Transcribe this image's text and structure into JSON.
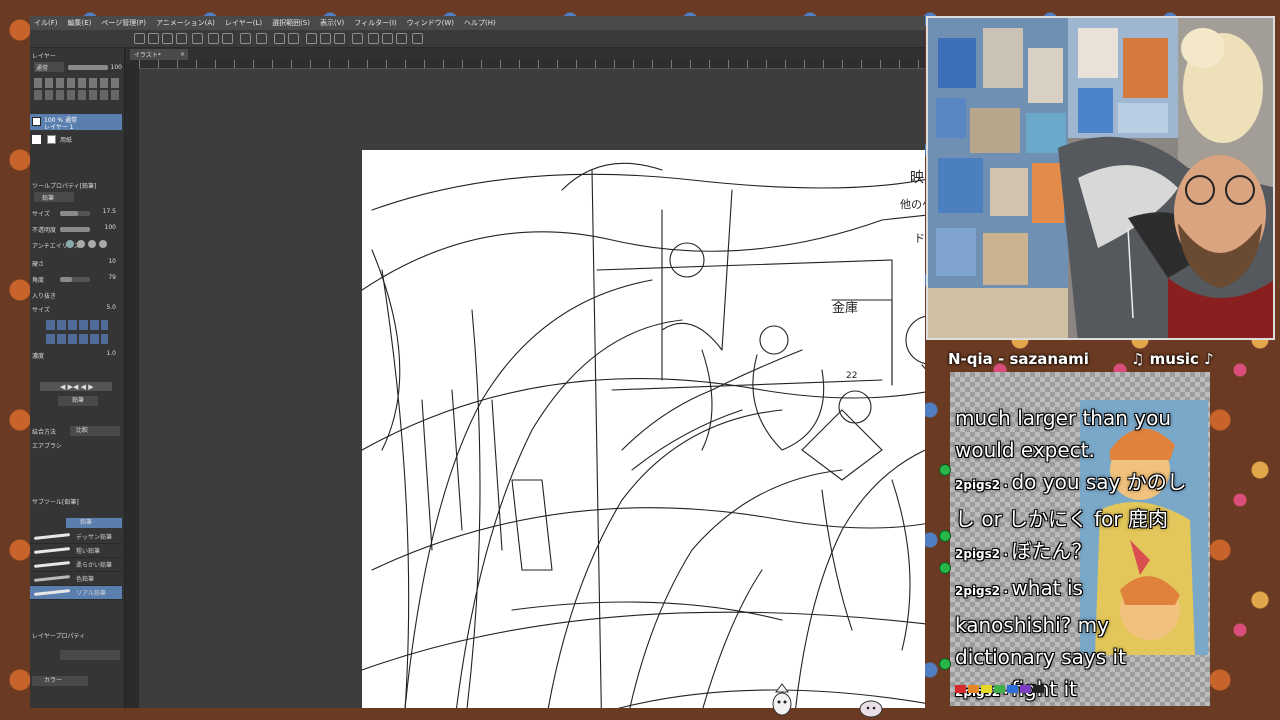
{
  "app": {
    "menu": [
      "イル(F)",
      "編集(E)",
      "ページ管理(P)",
      "アニメーション(A)",
      "レイヤー(L)",
      "選択範囲(S)",
      "表示(V)",
      "フィルター(I)",
      "ウィンドウ(W)",
      "ヘルプ(H)"
    ],
    "document_tab": "イラスト*",
    "zoom": "100",
    "layers": {
      "title": "レイヤー",
      "blend_mode": "通常",
      "layer_1_info": "100 % 通常",
      "layer_1_name": "レイヤー 1",
      "paper_layer": "用紙"
    },
    "tool_property": {
      "title": "ツールプロパティ[鉛筆]",
      "subtool": "鉛筆",
      "rows": [
        {
          "label": "サイズ",
          "value": "17.5"
        },
        {
          "label": "不透明度",
          "value": "100"
        },
        {
          "label": "アンチエイリアス",
          "value": ""
        },
        {
          "label": "硬さ",
          "value": "10"
        },
        {
          "label": "角度",
          "value": "79"
        },
        {
          "label": "入り抜き",
          "value": ""
        },
        {
          "label": "サイズ",
          "value": "5.0"
        },
        {
          "label": "濃度",
          "value": "1.0"
        }
      ],
      "merge_label": "結合方法",
      "merge_value": "比較",
      "airbrush_label": "エアブラシ",
      "pencil_button": "鉛筆"
    },
    "subtools": {
      "title": "サブツール[鉛筆]",
      "tab_label": "鉛筆",
      "items": [
        "デッサン鉛筆",
        "粗い鉛筆",
        "柔らかい鉛筆",
        "色鉛筆",
        "リアル鉛筆"
      ]
    },
    "layer_property": "レイヤープロパティ",
    "color_dropdown": "カラー"
  },
  "sketch_notes": {
    "top_right": "映ゲート",
    "note_line_1": "他のゲームはいっ",
    "note_line_2": "ドーナツ",
    "inner_note_1": "金庫",
    "inner_note_2": "22"
  },
  "stream": {
    "song": "N-qia - sazanami",
    "music_label": "♫ music ♪",
    "chat": [
      {
        "user": "",
        "text": "much larger than you"
      },
      {
        "user": "",
        "text": "would expect."
      },
      {
        "user": "2pigs2",
        "text": "do you say かのし"
      },
      {
        "user": "",
        "text": "し or しかにく for 鹿肉"
      },
      {
        "user": "2pigs2",
        "text": "ぼたん？"
      },
      {
        "user": "2pigs2",
        "text": "what is"
      },
      {
        "user": "",
        "text": "kanoshishi? my"
      },
      {
        "user": "",
        "text": "dictionary says it"
      },
      {
        "user": "2pigs2",
        "text": "fight it"
      }
    ],
    "palette": [
      "#d62b2b",
      "#e6862b",
      "#e8d72b",
      "#3fb04a",
      "#2b6fd6",
      "#7b3fc4",
      "#222222"
    ]
  }
}
